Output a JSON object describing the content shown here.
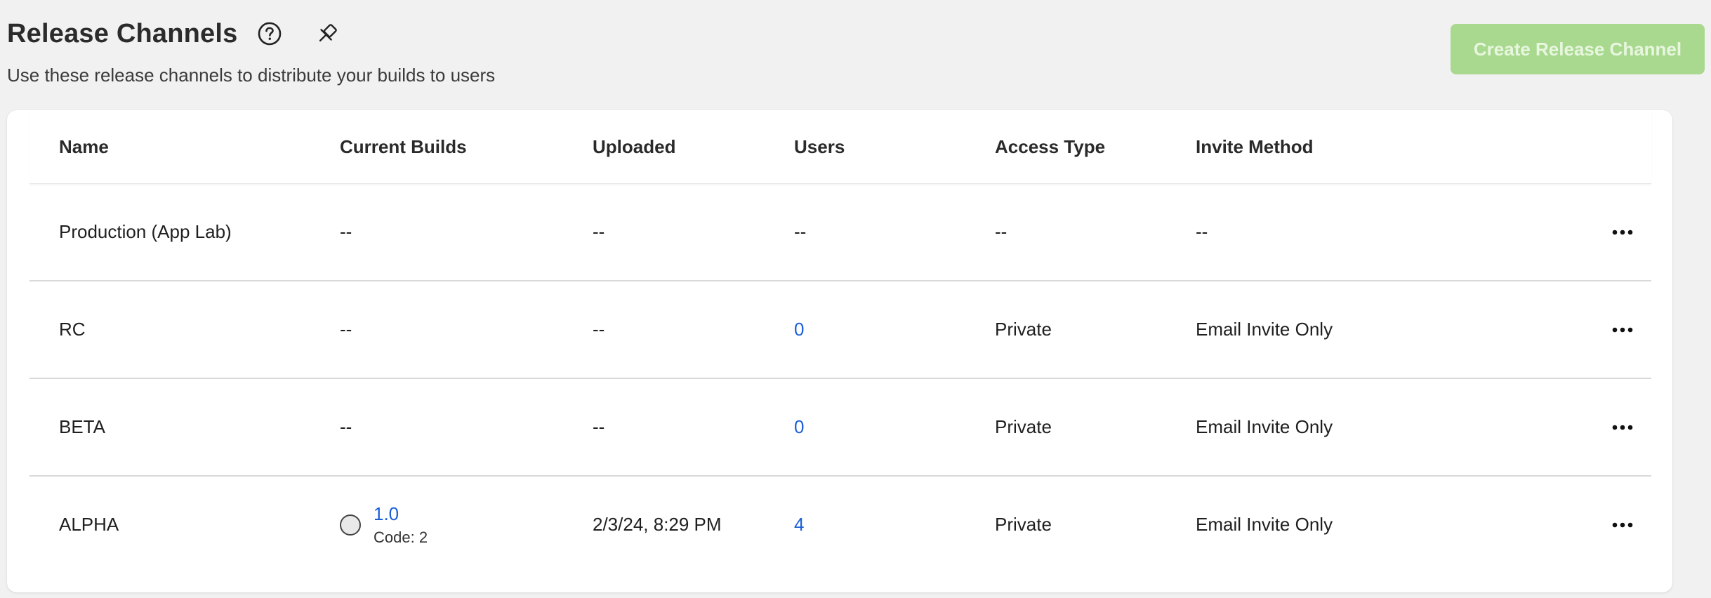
{
  "header": {
    "title": "Release Channels",
    "subtitle": "Use these release channels to distribute your builds to users",
    "create_button_label": "Create Release Channel"
  },
  "table": {
    "columns": [
      "Name",
      "Current Builds",
      "Uploaded",
      "Users",
      "Access Type",
      "Invite Method"
    ],
    "rows": [
      {
        "name": "Production (App Lab)",
        "current_build": "--",
        "uploaded": "--",
        "users": "--",
        "access_type": "--",
        "invite_method": "--"
      },
      {
        "name": "RC",
        "current_build": "--",
        "uploaded": "--",
        "users": "0",
        "access_type": "Private",
        "invite_method": "Email Invite Only"
      },
      {
        "name": "BETA",
        "current_build": "--",
        "uploaded": "--",
        "users": "0",
        "access_type": "Private",
        "invite_method": "Email Invite Only"
      },
      {
        "name": "ALPHA",
        "current_build": {
          "version": "1.0",
          "code": "Code: 2"
        },
        "uploaded": "2/3/24, 8:29 PM",
        "users": "4",
        "access_type": "Private",
        "invite_method": "Email Invite Only"
      }
    ]
  },
  "icons": {
    "help": "question-circle-icon",
    "pin": "pin-icon",
    "more": "more-horizontal-icon"
  },
  "colors": {
    "accent_button": "#a8d98f",
    "link": "#1a5fd8",
    "background": "#f1f1f1"
  }
}
